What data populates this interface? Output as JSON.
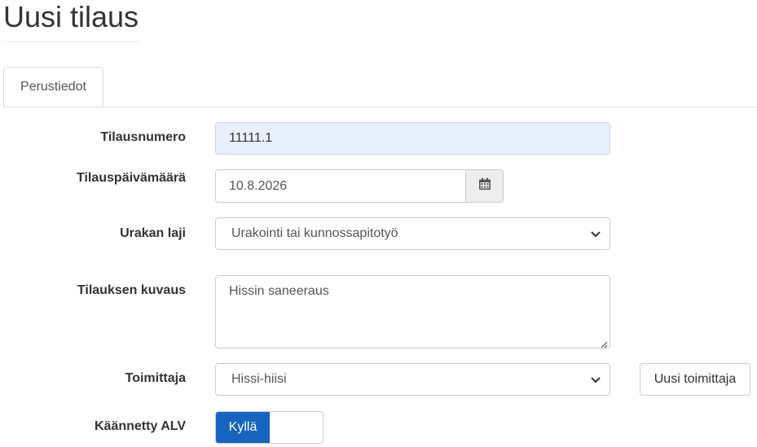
{
  "page": {
    "title": "Uusi tilaus"
  },
  "tabs": [
    {
      "label": "Perustiedot",
      "active": true
    }
  ],
  "form": {
    "order_number": {
      "label": "Tilausnumero",
      "value": "11111.1"
    },
    "order_date": {
      "label": "Tilauspäivämäärä",
      "value": "10.8.2026",
      "icon": "calendar-icon"
    },
    "contract_type": {
      "label": "Urakan laji",
      "value": "Urakointi tai kunnossapitotyö"
    },
    "description": {
      "label": "Tilauksen kuvaus",
      "value": "Hissin saneeraus"
    },
    "supplier": {
      "label": "Toimittaja",
      "value": "Hissi-hiisi",
      "new_button_label": "Uusi toimittaja"
    },
    "reverse_vat": {
      "label": "Käännetty ALV",
      "on_label": "Kyllä",
      "checked": true
    }
  },
  "colors": {
    "accent": "#1565c0",
    "autofill": "#e8f0fe"
  }
}
